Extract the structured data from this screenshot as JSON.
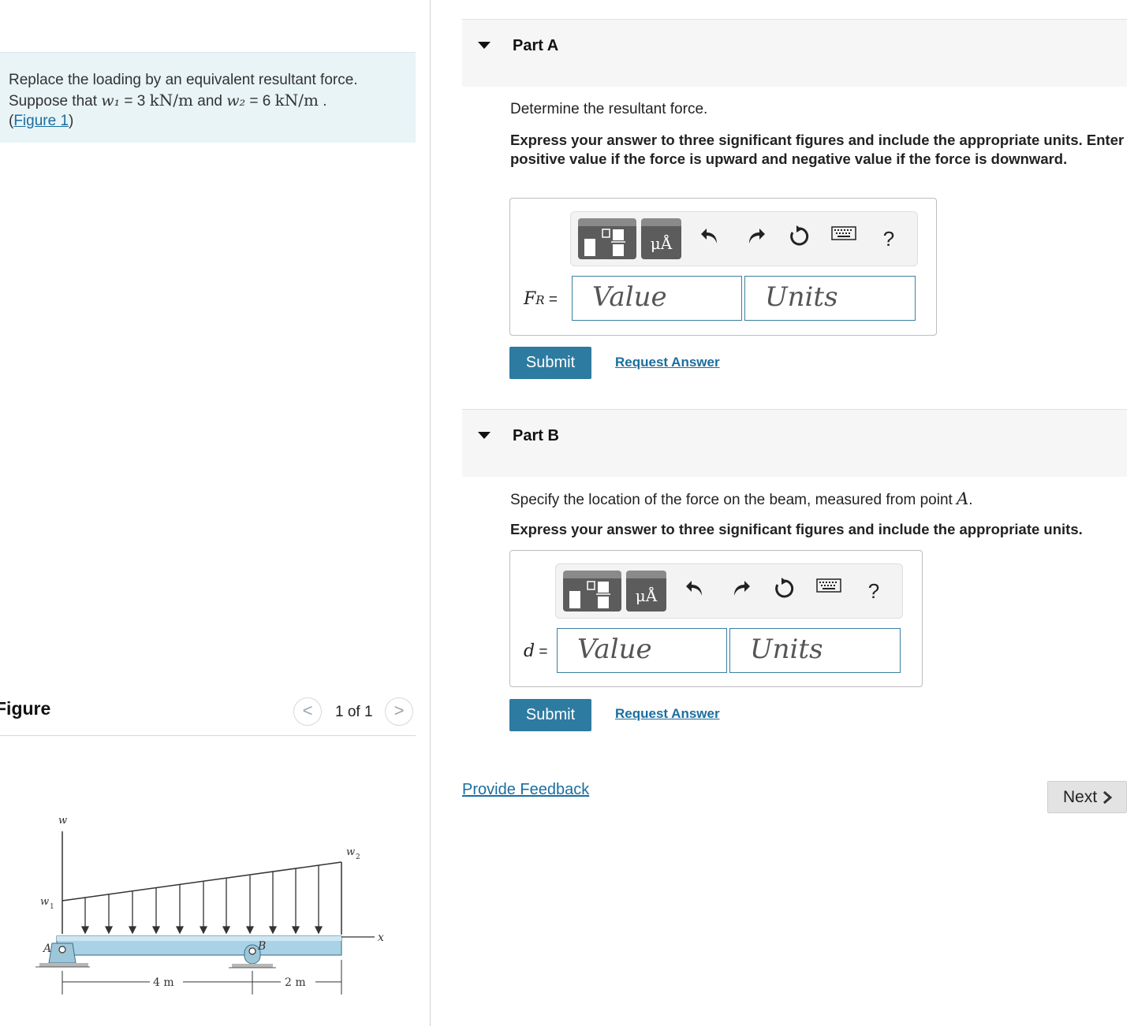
{
  "problem": {
    "line1": "Replace the loading by an equivalent resultant force.",
    "suppose_prefix": "Suppose that",
    "w1_var": "w₁",
    "w1_eq": " = 3 ",
    "w1_unit": "kN/m",
    "and": " and ",
    "w2_var": "w₂",
    "w2_eq": " = 6 ",
    "w2_unit": "kN/m",
    "end": " .",
    "figure_link": "Figure 1"
  },
  "figure": {
    "title": "Figure",
    "prev": "<",
    "next": ">",
    "count": "1 of 1",
    "labels": {
      "w": "w",
      "w1": "w",
      "w1_sub": "1",
      "w2": "w",
      "w2_sub": "2",
      "A": "A",
      "B": "B",
      "x": "x",
      "dim1": "4 m",
      "dim2": "2 m"
    }
  },
  "partA": {
    "title": "Part A",
    "question": "Determine the resultant force.",
    "instructions": "Express your answer to three significant figures and include the appropriate units. Enter positive value if the force is upward and negative value if the force is downward.",
    "var_main": "F",
    "var_sub": "R",
    "var_eq": " =",
    "value_placeholder": "Value",
    "units_placeholder": "Units",
    "submit": "Submit",
    "request": "Request Answer"
  },
  "partB": {
    "title": "Part B",
    "question_prefix": "Specify the location of the force on the beam, measured from point ",
    "question_point": "A",
    "question_end": ".",
    "instructions": "Express your answer to three significant figures and include the appropriate units.",
    "var_main": "d",
    "var_eq": " =",
    "value_placeholder": "Value",
    "units_placeholder": "Units",
    "submit": "Submit",
    "request": "Request Answer"
  },
  "toolbar": {
    "units_button_text": "μÅ",
    "help": "?",
    "icons": [
      "templates-icon",
      "units-icon",
      "undo-icon",
      "redo-icon",
      "reset-icon",
      "keyboard-icon",
      "help-icon"
    ]
  },
  "footer": {
    "feedback": "Provide Feedback",
    "next": "Next"
  }
}
